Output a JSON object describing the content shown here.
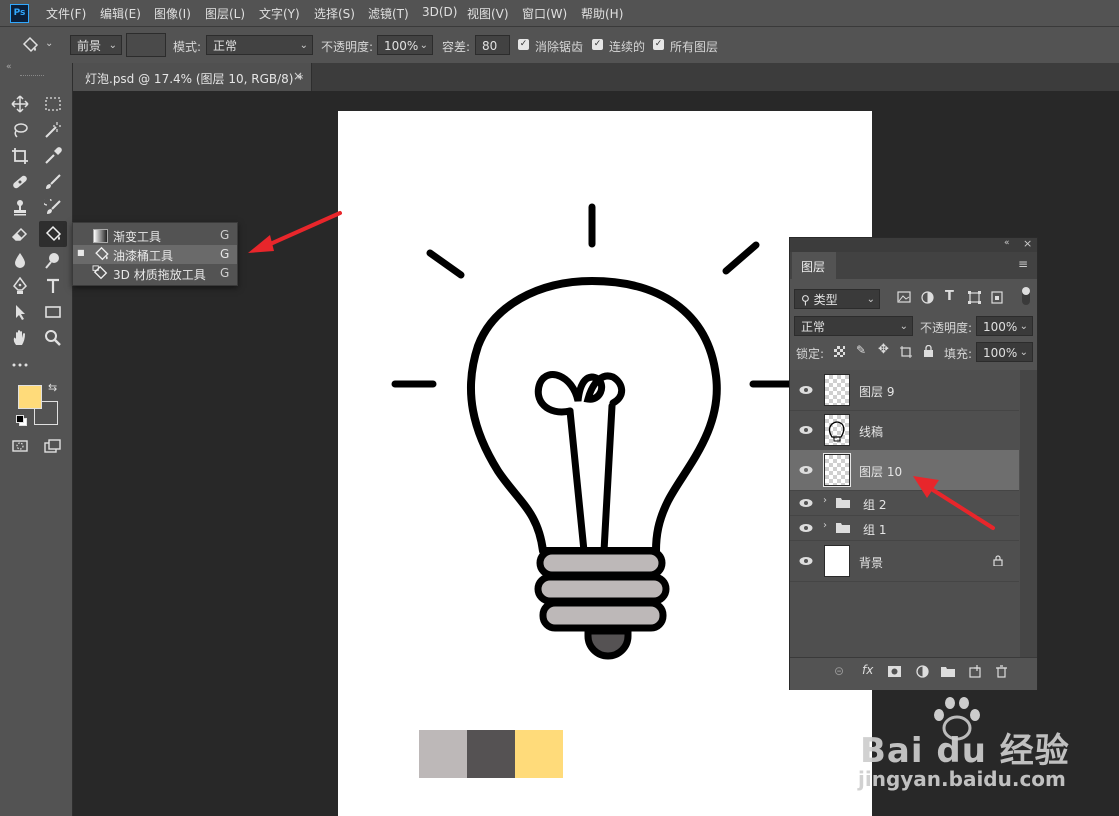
{
  "app": {
    "logo_text": "Ps"
  },
  "menu": [
    "文件(F)",
    "编辑(E)",
    "图像(I)",
    "图层(L)",
    "文字(Y)",
    "选择(S)",
    "滤镜(T)",
    "3D(D)",
    "视图(V)",
    "窗口(W)",
    "帮助(H)"
  ],
  "options": {
    "fill_source": "前景",
    "mode_label": "模式:",
    "mode_value": "正常",
    "opacity_label": "不透明度:",
    "opacity_value": "100%",
    "tolerance_label": "容差:",
    "tolerance_value": "80",
    "antialias_label": "消除锯齿",
    "contiguous_label": "连续的",
    "all_layers_label": "所有图层"
  },
  "document_tab": {
    "title": "灯泡.psd @ 17.4% (图层 10, RGB/8) *",
    "close": "×"
  },
  "flyout": [
    {
      "label": "渐变工具",
      "shortcut": "G",
      "selected": false
    },
    {
      "label": "油漆桶工具",
      "shortcut": "G",
      "selected": true
    },
    {
      "label": "3D 材质拖放工具",
      "shortcut": "G",
      "selected": false
    }
  ],
  "colors": {
    "foreground": "#ffdb7a",
    "background": "#535353",
    "accent_arrow": "#e8262b"
  },
  "swatches": [
    "#bdb8b8",
    "#555253",
    "#ffdb7a"
  ],
  "layers_panel": {
    "tab": "图层",
    "filter_label": "类型",
    "blend_mode": "正常",
    "opacity_label": "不透明度:",
    "opacity_value": "100%",
    "lock_label": "锁定:",
    "fill_label": "填充:",
    "fill_value": "100%",
    "layers": [
      {
        "name": "图层 9",
        "type": "layer",
        "selected": false
      },
      {
        "name": "线稿",
        "type": "layer",
        "selected": false
      },
      {
        "name": "图层 10",
        "type": "layer",
        "selected": true
      },
      {
        "name": "组 2",
        "type": "group",
        "selected": false
      },
      {
        "name": "组 1",
        "type": "group",
        "selected": false
      },
      {
        "name": "背景",
        "type": "background",
        "selected": false
      }
    ]
  },
  "watermark": {
    "brand": "Bai du 经验",
    "url": "jingyan.baidu.com"
  }
}
